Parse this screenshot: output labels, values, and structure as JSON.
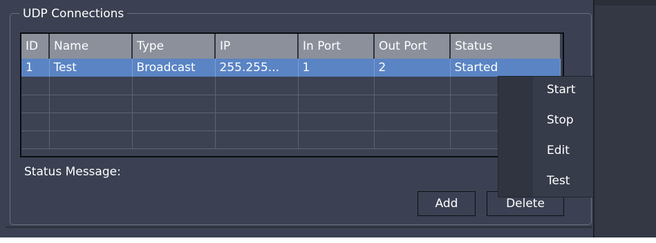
{
  "group": {
    "title": "UDP Connections"
  },
  "table": {
    "columns": [
      "ID",
      "Name",
      "Type",
      "IP",
      "In Port",
      "Out Port",
      "Status"
    ],
    "rows": [
      {
        "id": "1",
        "name": "Test",
        "type": "Broadcast",
        "ip": "255.255...",
        "in_port": "1",
        "out_port": "2",
        "status": "Started"
      }
    ]
  },
  "status_message": {
    "label": "Status Message:"
  },
  "buttons": {
    "add": "Add",
    "delete": "Delete"
  },
  "context_menu": {
    "items": [
      "Start",
      "Stop",
      "Edit",
      "Test"
    ]
  },
  "colors": {
    "background": "#3b4152",
    "header": "#8b909b",
    "selection": "#5a84c4",
    "menu": "#373c4a"
  }
}
